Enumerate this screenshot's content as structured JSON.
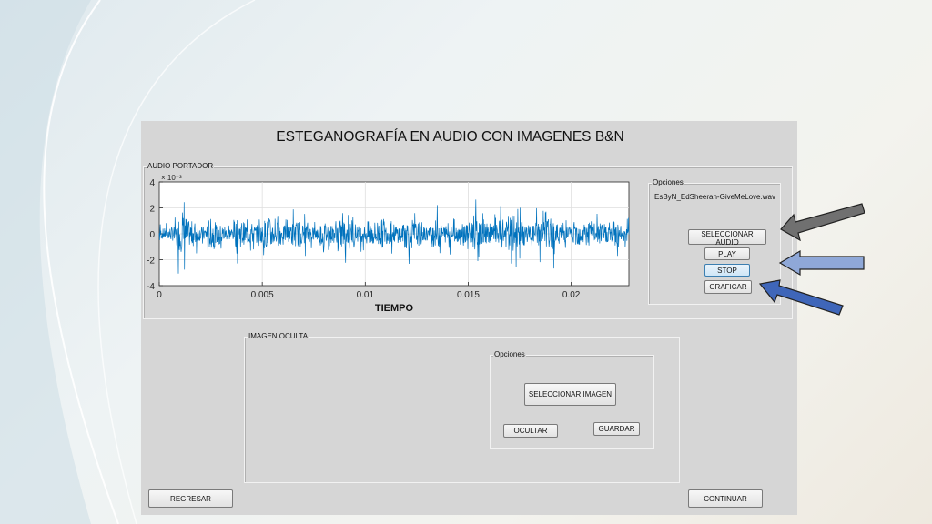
{
  "window": {
    "title": "ESTEGANOGRAFÍA EN AUDIO CON IMAGENES B&N"
  },
  "audio_panel": {
    "title": "AUDIO PORTADOR",
    "options_title": "Opciones",
    "filename": "EsByN_EdSheeran-GiveMeLove.wav",
    "buttons": {
      "select_audio": "SELECCIONAR AUDIO",
      "play": "PLAY",
      "stop": "STOP",
      "plot": "GRAFICAR"
    }
  },
  "image_panel": {
    "title": "IMAGEN OCULTA",
    "options_title": "Opciones",
    "buttons": {
      "select_image": "SELECCIONAR IMAGEN",
      "hide": "OCULTAR",
      "save": "GUARDAR"
    }
  },
  "footer": {
    "back": "REGRESAR",
    "continue": "CONTINUAR"
  },
  "chart_data": {
    "type": "line",
    "xlabel": "TIEMPO",
    "ylabel": "",
    "exponent_label": "× 10⁻³",
    "xlim": [
      0,
      0.0228
    ],
    "ylim": [
      -4,
      4
    ],
    "xticks": [
      0,
      0.005,
      0.01,
      0.015,
      0.02
    ],
    "xtick_labels": [
      "0",
      "0.005",
      "0.01",
      "0.015",
      "0.02"
    ],
    "yticks": [
      4,
      2,
      0,
      -2,
      -4
    ],
    "ytick_labels": [
      "4",
      "2",
      "0",
      "-2",
      "-4"
    ],
    "grid": true,
    "line_color": "#0072BD",
    "series": [
      {
        "x_start": 0,
        "x_end": 0.0228,
        "envelope": [
          0.6,
          0.8,
          2.0,
          1.4,
          0.8,
          1.7,
          1.0,
          0.7,
          1.5,
          1.2,
          1.0,
          1.6,
          1.3,
          0.9,
          1.4,
          1.1,
          0.8,
          1.3,
          1.0,
          1.5,
          1.2,
          0.9,
          1.4,
          1.6,
          1.1,
          1.0,
          1.7,
          1.3,
          0.8,
          1.5,
          1.0,
          0.9,
          1.3,
          1.8,
          1.2,
          1.0,
          1.6,
          2.1,
          1.4,
          1.0,
          1.5,
          1.7,
          1.1,
          0.9,
          1.3,
          1.5,
          1.2,
          1.0,
          1.6,
          0.9
        ]
      }
    ]
  },
  "annotations": {
    "arrow_colors": [
      "#707070",
      "#8fa8d8",
      "#3f66b9"
    ]
  }
}
